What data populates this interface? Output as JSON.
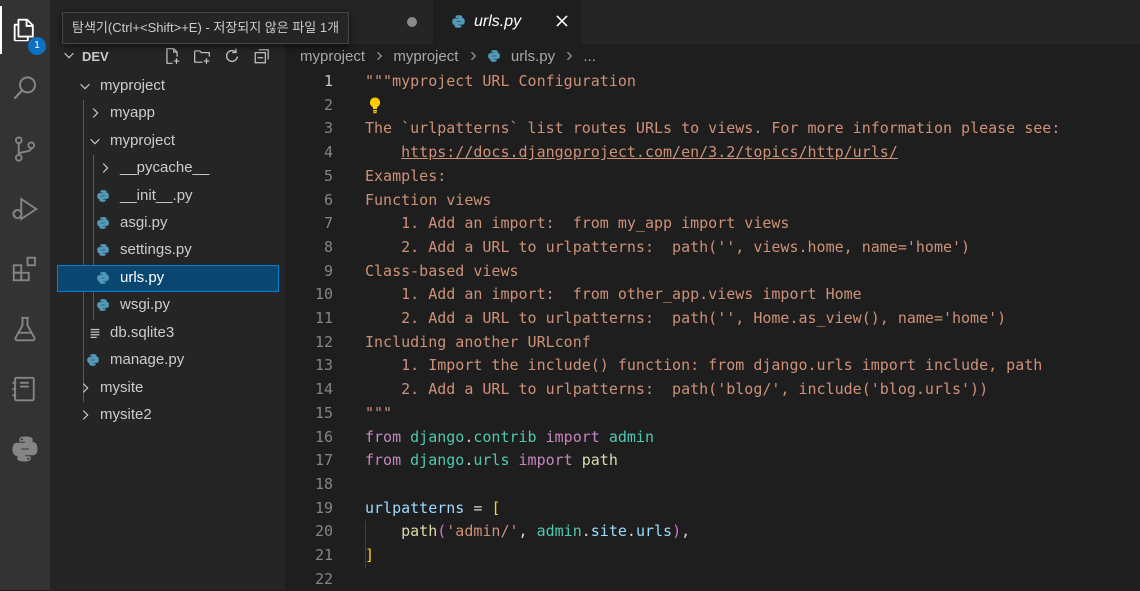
{
  "tooltip": "탐색기(Ctrl+<Shift>+E) - 저장되지 않은 파일 1개",
  "activity_bar": {
    "explorer_badge": "1",
    "icons": [
      "files-icon",
      "search-icon",
      "source-control-icon",
      "run-debug-icon",
      "extensions-icon",
      "testing-icon",
      "notebook-icon",
      "python-icon"
    ]
  },
  "explorer": {
    "section_title": "DEV",
    "tree": [
      {
        "label": "myproject",
        "kind": "folder-open"
      },
      {
        "label": "myapp",
        "kind": "folder-closed"
      },
      {
        "label": "myproject",
        "kind": "folder-open"
      },
      {
        "label": "__pycache__",
        "kind": "folder-closed"
      },
      {
        "label": "__init__.py",
        "kind": "python-file"
      },
      {
        "label": "asgi.py",
        "kind": "python-file"
      },
      {
        "label": "settings.py",
        "kind": "python-file"
      },
      {
        "label": "urls.py",
        "kind": "python-file",
        "selected": true
      },
      {
        "label": "wsgi.py",
        "kind": "python-file"
      },
      {
        "label": "db.sqlite3",
        "kind": "text-file"
      },
      {
        "label": "manage.py",
        "kind": "python-file"
      },
      {
        "label": "mysite",
        "kind": "folder-closed"
      },
      {
        "label": "mysite2",
        "kind": "folder-closed"
      }
    ]
  },
  "editor": {
    "tab_label": "urls.py",
    "breadcrumb": [
      "myproject",
      "myproject",
      "urls.py",
      "..."
    ],
    "current_line": 1,
    "line_numbers": [
      "1",
      "2",
      "3",
      "4",
      "5",
      "6",
      "7",
      "8",
      "9",
      "10",
      "11",
      "12",
      "13",
      "14",
      "15",
      "16",
      "17",
      "18",
      "19",
      "20",
      "21",
      "22"
    ],
    "code": {
      "l1": "\"\"\"myproject URL Configuration",
      "l3": "The `urlpatterns` list routes URLs to views. For more information please see:",
      "l4_indent": "    ",
      "l4_link": "https://docs.djangoproject.com/en/3.2/topics/http/urls/",
      "l5": "Examples:",
      "l6": "Function views",
      "l7": "    1. Add an import:  from my_app import views",
      "l8": "    2. Add a URL to urlpatterns:  path('', views.home, name='home')",
      "l9": "Class-based views",
      "l10": "    1. Add an import:  from other_app.views import Home",
      "l11": "    2. Add a URL to urlpatterns:  path('', Home.as_view(), name='home')",
      "l12": "Including another URLconf",
      "l13": "    1. Import the include() function: from django.urls import include, path",
      "l14": "    2. Add a URL to urlpatterns:  path('blog/', include('blog.urls'))",
      "l15": "\"\"\"",
      "kw_from": "from",
      "kw_import": "import",
      "django": "django",
      "dot": ".",
      "contrib": "contrib",
      "admin": "admin",
      "urls": "urls",
      "path": "path",
      "urlpatterns": "urlpatterns",
      "eq": " = ",
      "lbracket": "[",
      "rbracket": "]",
      "indent": "    ",
      "lparen": "(",
      "rparen": ")",
      "str_admin": "'admin/'",
      "comma_sp": ", ",
      "site": "site",
      "trail_comma": ","
    }
  },
  "colors": {
    "accent": "#0e70c0",
    "selection": "#094771",
    "docstring": "#ce9178",
    "keyword": "#c586c0",
    "module": "#4ec9b0",
    "variable": "#9cdcfe"
  }
}
